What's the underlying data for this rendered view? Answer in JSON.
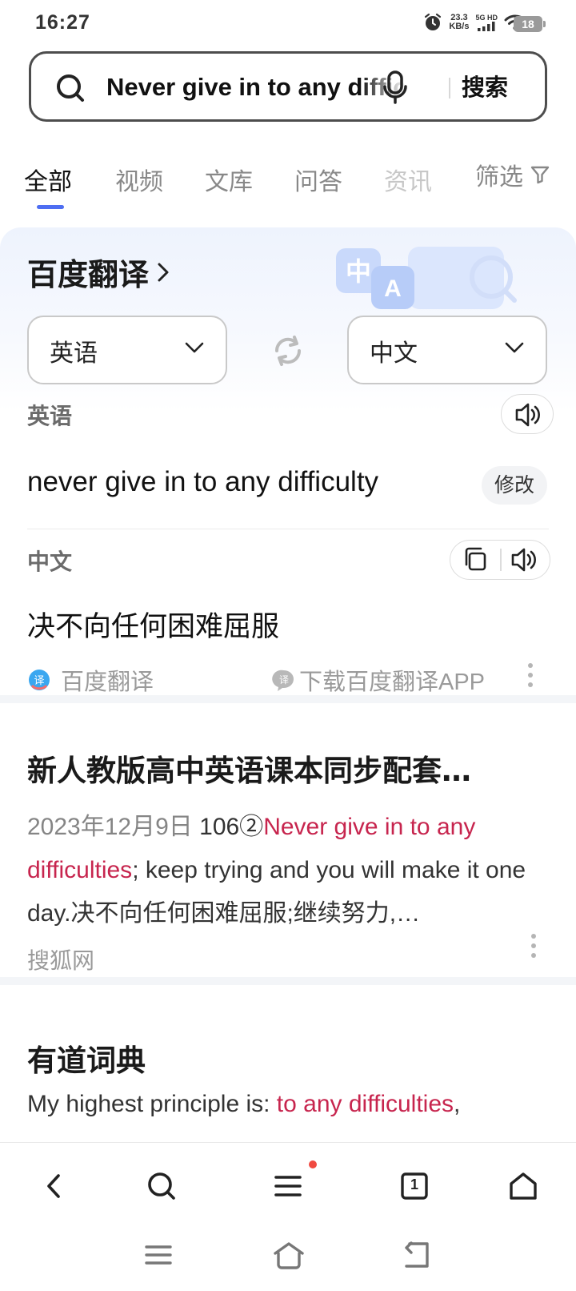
{
  "status_bar": {
    "time": "16:27",
    "net_speed_value": "23.3",
    "net_speed_unit": "KB/s",
    "signal_label": "5G HD",
    "battery": "18"
  },
  "search": {
    "query": "Never give in to any difficulty",
    "button": "搜索"
  },
  "tabs": [
    {
      "label": "全部",
      "active": true
    },
    {
      "label": "视频"
    },
    {
      "label": "文库"
    },
    {
      "label": "问答"
    },
    {
      "label": "资讯"
    }
  ],
  "filter_label": "筛选",
  "translate": {
    "title": "百度翻译",
    "source_lang": "英语",
    "target_lang": "中文",
    "source_label": "英语",
    "source_text": "never give in to any difficulty",
    "edit_label": "修改",
    "target_label": "中文",
    "target_text": "决不向任何困难屈服",
    "brand": "百度翻译",
    "download": "下载百度翻译APP",
    "deco_glyphs": [
      "中",
      "A"
    ]
  },
  "result1": {
    "title": "新人教版高中英语课本同步配套…",
    "date": "2023年12月9日",
    "snippet_pre": " 106②",
    "snippet_hl": "Never give in to any difficulties",
    "snippet_post": "; keep trying and you will make it one day.决不向任何困难屈服;继续努力,…",
    "source": "搜狐网"
  },
  "result2": {
    "title": "有道词典",
    "snippet_pre": "My highest principle is: ",
    "snippet_hl": "to any difficulties",
    "snippet_post": ","
  },
  "bottom_nav": {
    "tab_count": "1"
  },
  "colors": {
    "accent": "#4e6ef2",
    "highlight": "#c7254e",
    "notify_dot": "#f04a41"
  },
  "icons": [
    "alarm-icon",
    "wifi-icon",
    "search-icon",
    "mic-icon",
    "filter-icon",
    "chevron-right-icon",
    "chevron-down-icon",
    "swap-icon",
    "speaker-icon",
    "copy-icon",
    "back-icon",
    "menu-icon",
    "tabs-icon",
    "home-icon"
  ]
}
